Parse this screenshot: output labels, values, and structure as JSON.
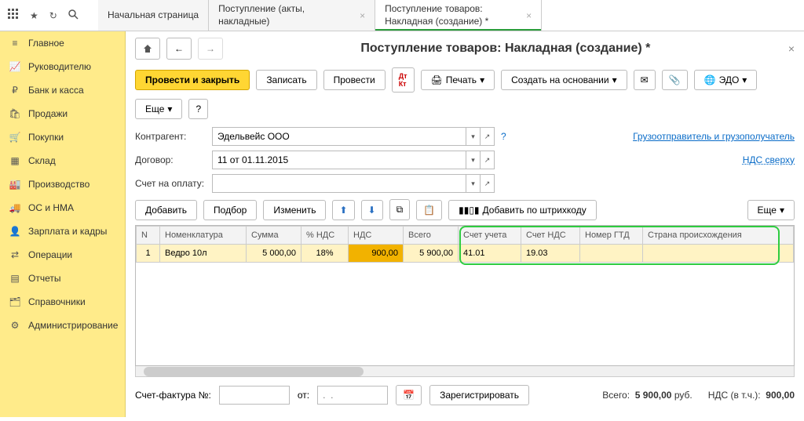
{
  "topbar": {
    "tabs": [
      {
        "label": "Начальная страница",
        "closable": false,
        "active": false
      },
      {
        "label": "Поступление (акты, накладные)",
        "closable": true,
        "active": false
      },
      {
        "label": "Поступление товаров: Накладная (создание) *",
        "closable": true,
        "active": true
      }
    ]
  },
  "sidebar": {
    "items": [
      {
        "key": "main",
        "label": "Главное"
      },
      {
        "key": "manager",
        "label": "Руководителю"
      },
      {
        "key": "bank",
        "label": "Банк и касса"
      },
      {
        "key": "sales",
        "label": "Продажи"
      },
      {
        "key": "purchases",
        "label": "Покупки"
      },
      {
        "key": "warehouse",
        "label": "Склад"
      },
      {
        "key": "production",
        "label": "Производство"
      },
      {
        "key": "fixed",
        "label": "ОС и НМА"
      },
      {
        "key": "payroll",
        "label": "Зарплата и кадры"
      },
      {
        "key": "operations",
        "label": "Операции"
      },
      {
        "key": "reports",
        "label": "Отчеты"
      },
      {
        "key": "reference",
        "label": "Справочники"
      },
      {
        "key": "admin",
        "label": "Администрирование"
      }
    ]
  },
  "document": {
    "title": "Поступление товаров: Накладная (создание) *"
  },
  "toolbar": {
    "post_and_close": "Провести и закрыть",
    "write": "Записать",
    "post": "Провести",
    "print": "Печать",
    "create_based_on": "Создать на основании",
    "edo": "ЭДО",
    "more": "Еще",
    "help": "?"
  },
  "form": {
    "counterparty_label": "Контрагент:",
    "counterparty_value": "Эдельвейс ООО",
    "contract_label": "Договор:",
    "contract_value": "11 от 01.11.2015",
    "invoice_label": "Счет на оплату:",
    "invoice_value": "",
    "question": "?",
    "shipper_link": "Грузоотправитель и грузополучатель",
    "vat_link": "НДС сверху"
  },
  "table_toolbar": {
    "add": "Добавить",
    "pick": "Подбор",
    "change": "Изменить",
    "barcode": "Добавить по штрихкоду",
    "more": "Еще"
  },
  "table": {
    "columns": [
      "N",
      "Номенклатура",
      "Сумма",
      "% НДС",
      "НДС",
      "Всего",
      "Счет учета",
      "Счет НДС",
      "Номер ГТД",
      "Страна происхождения"
    ],
    "rows": [
      {
        "n": "1",
        "item": "Ведро 10л",
        "sum": "5 000,00",
        "vat_rate": "18%",
        "vat": "900,00",
        "total": "5 900,00",
        "acct": "41.01",
        "vat_acct": "19.03",
        "gtd": "",
        "country": ""
      }
    ]
  },
  "footer": {
    "invoice_no_label": "Счет-фактура №:",
    "from_label": "от:",
    "date_placeholder": ".  .",
    "register": "Зарегистрировать",
    "total_label": "Всего:",
    "total_value": "5 900,00",
    "currency": "руб.",
    "vat_label": "НДС (в т.ч.):",
    "vat_value": "900,00"
  }
}
